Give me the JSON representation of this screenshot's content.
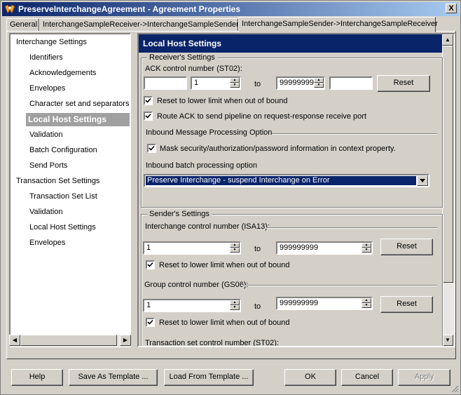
{
  "window": {
    "title": "PreserveInterchangeAgreement - Agreement Properties",
    "close_label": "X"
  },
  "tabs": [
    {
      "label": "General"
    },
    {
      "label": "InterchangeSampleReceiver->InterchangeSampleSender"
    },
    {
      "label": "InterchangeSampleSender->InterchangeSampleReceiver"
    }
  ],
  "tree": {
    "items": [
      {
        "label": "Interchange Settings"
      },
      {
        "label": "Identifiers"
      },
      {
        "label": "Acknowledgements"
      },
      {
        "label": "Envelopes"
      },
      {
        "label": "Character set and separators"
      },
      {
        "label": "Local Host Settings"
      },
      {
        "label": "Validation"
      },
      {
        "label": "Batch Configuration"
      },
      {
        "label": "Send Ports"
      },
      {
        "label": "Transaction Set Settings"
      },
      {
        "label": "Transaction Set List"
      },
      {
        "label": "Validation"
      },
      {
        "label": "Local Host Settings"
      },
      {
        "label": "Envelopes"
      }
    ]
  },
  "panel": {
    "header": "Local Host Settings",
    "receiver": {
      "group_title": "Receiver's Settings",
      "ack_label": "ACK control number (ST02):",
      "ack_prefix": "",
      "ack_from": "1",
      "to_label": "to",
      "ack_to": "99999999",
      "ack_suffix": "",
      "reset_label": "Reset",
      "reset_check_label": "Reset to lower limit when out of bound",
      "route_check_label": "Route ACK to send pipeline on request-response receive port",
      "inbound_section": "Inbound Message Processing Option",
      "mask_check_label": "Mask security/authorization/password information in context property.",
      "batch_label": "Inbound batch processing option",
      "batch_value": "Preserve Interchange - suspend Interchange on Error"
    },
    "sender": {
      "group_title": "Sender's Settings",
      "isa_label": "Interchange control number (ISA13):",
      "isa_from": "1",
      "to_label": "to",
      "isa_to": "999999999",
      "reset_label": "Reset",
      "isa_check_label": "Reset to lower limit when out of bound",
      "gs_label": "Group control number (GS06):",
      "gs_from": "1",
      "gs_to": "999999999",
      "gs_check_label": "Reset to lower limit when out of bound",
      "st_label": "Transaction set control number (ST02):"
    }
  },
  "buttons": {
    "help": "Help",
    "save_template": "Save As Template ...",
    "load_template": "Load From Template ...",
    "ok": "OK",
    "cancel": "Cancel",
    "apply": "Apply"
  }
}
